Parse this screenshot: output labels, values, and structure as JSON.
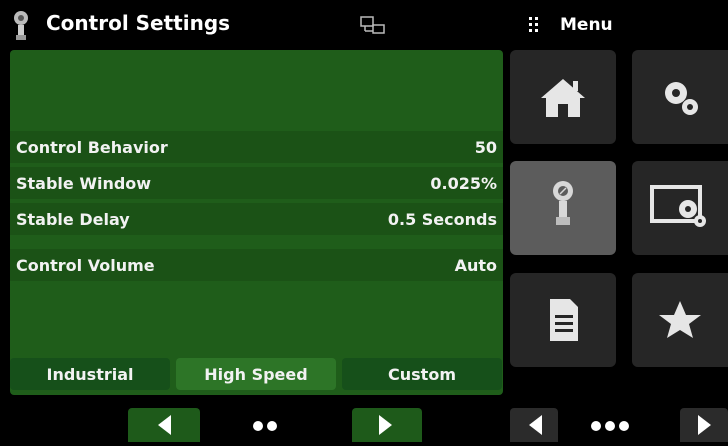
{
  "header": {
    "title": "Control Settings",
    "menu_label": "Menu",
    "icons": {
      "app": "pressure-gauge-icon",
      "network": "network-icon",
      "menu": "grip-icon"
    }
  },
  "settings": {
    "rows": [
      {
        "label": "Control Behavior",
        "value": "50"
      },
      {
        "label": "Stable Window",
        "value": "0.025%"
      },
      {
        "label": "Stable Delay",
        "value": "0.5 Seconds"
      },
      {
        "label": "Control Volume",
        "value": "Auto"
      }
    ],
    "presets": [
      {
        "label": "Industrial",
        "selected": false
      },
      {
        "label": "High Speed",
        "selected": true
      },
      {
        "label": "Custom",
        "selected": false
      }
    ]
  },
  "menu_tiles": [
    {
      "icon": "home-icon",
      "selected": false
    },
    {
      "icon": "settings-gears-icon",
      "selected": false
    },
    {
      "icon": "controller-icon",
      "selected": true
    },
    {
      "icon": "display-settings-icon",
      "selected": false
    },
    {
      "icon": "document-icon",
      "selected": false
    },
    {
      "icon": "star-icon",
      "selected": false
    }
  ],
  "colors": {
    "panel": "#1f5d1a",
    "row": "#1b5216",
    "tab_selected": "#2d7527",
    "tile": "#262626",
    "tile_selected": "#5c5c5c"
  }
}
